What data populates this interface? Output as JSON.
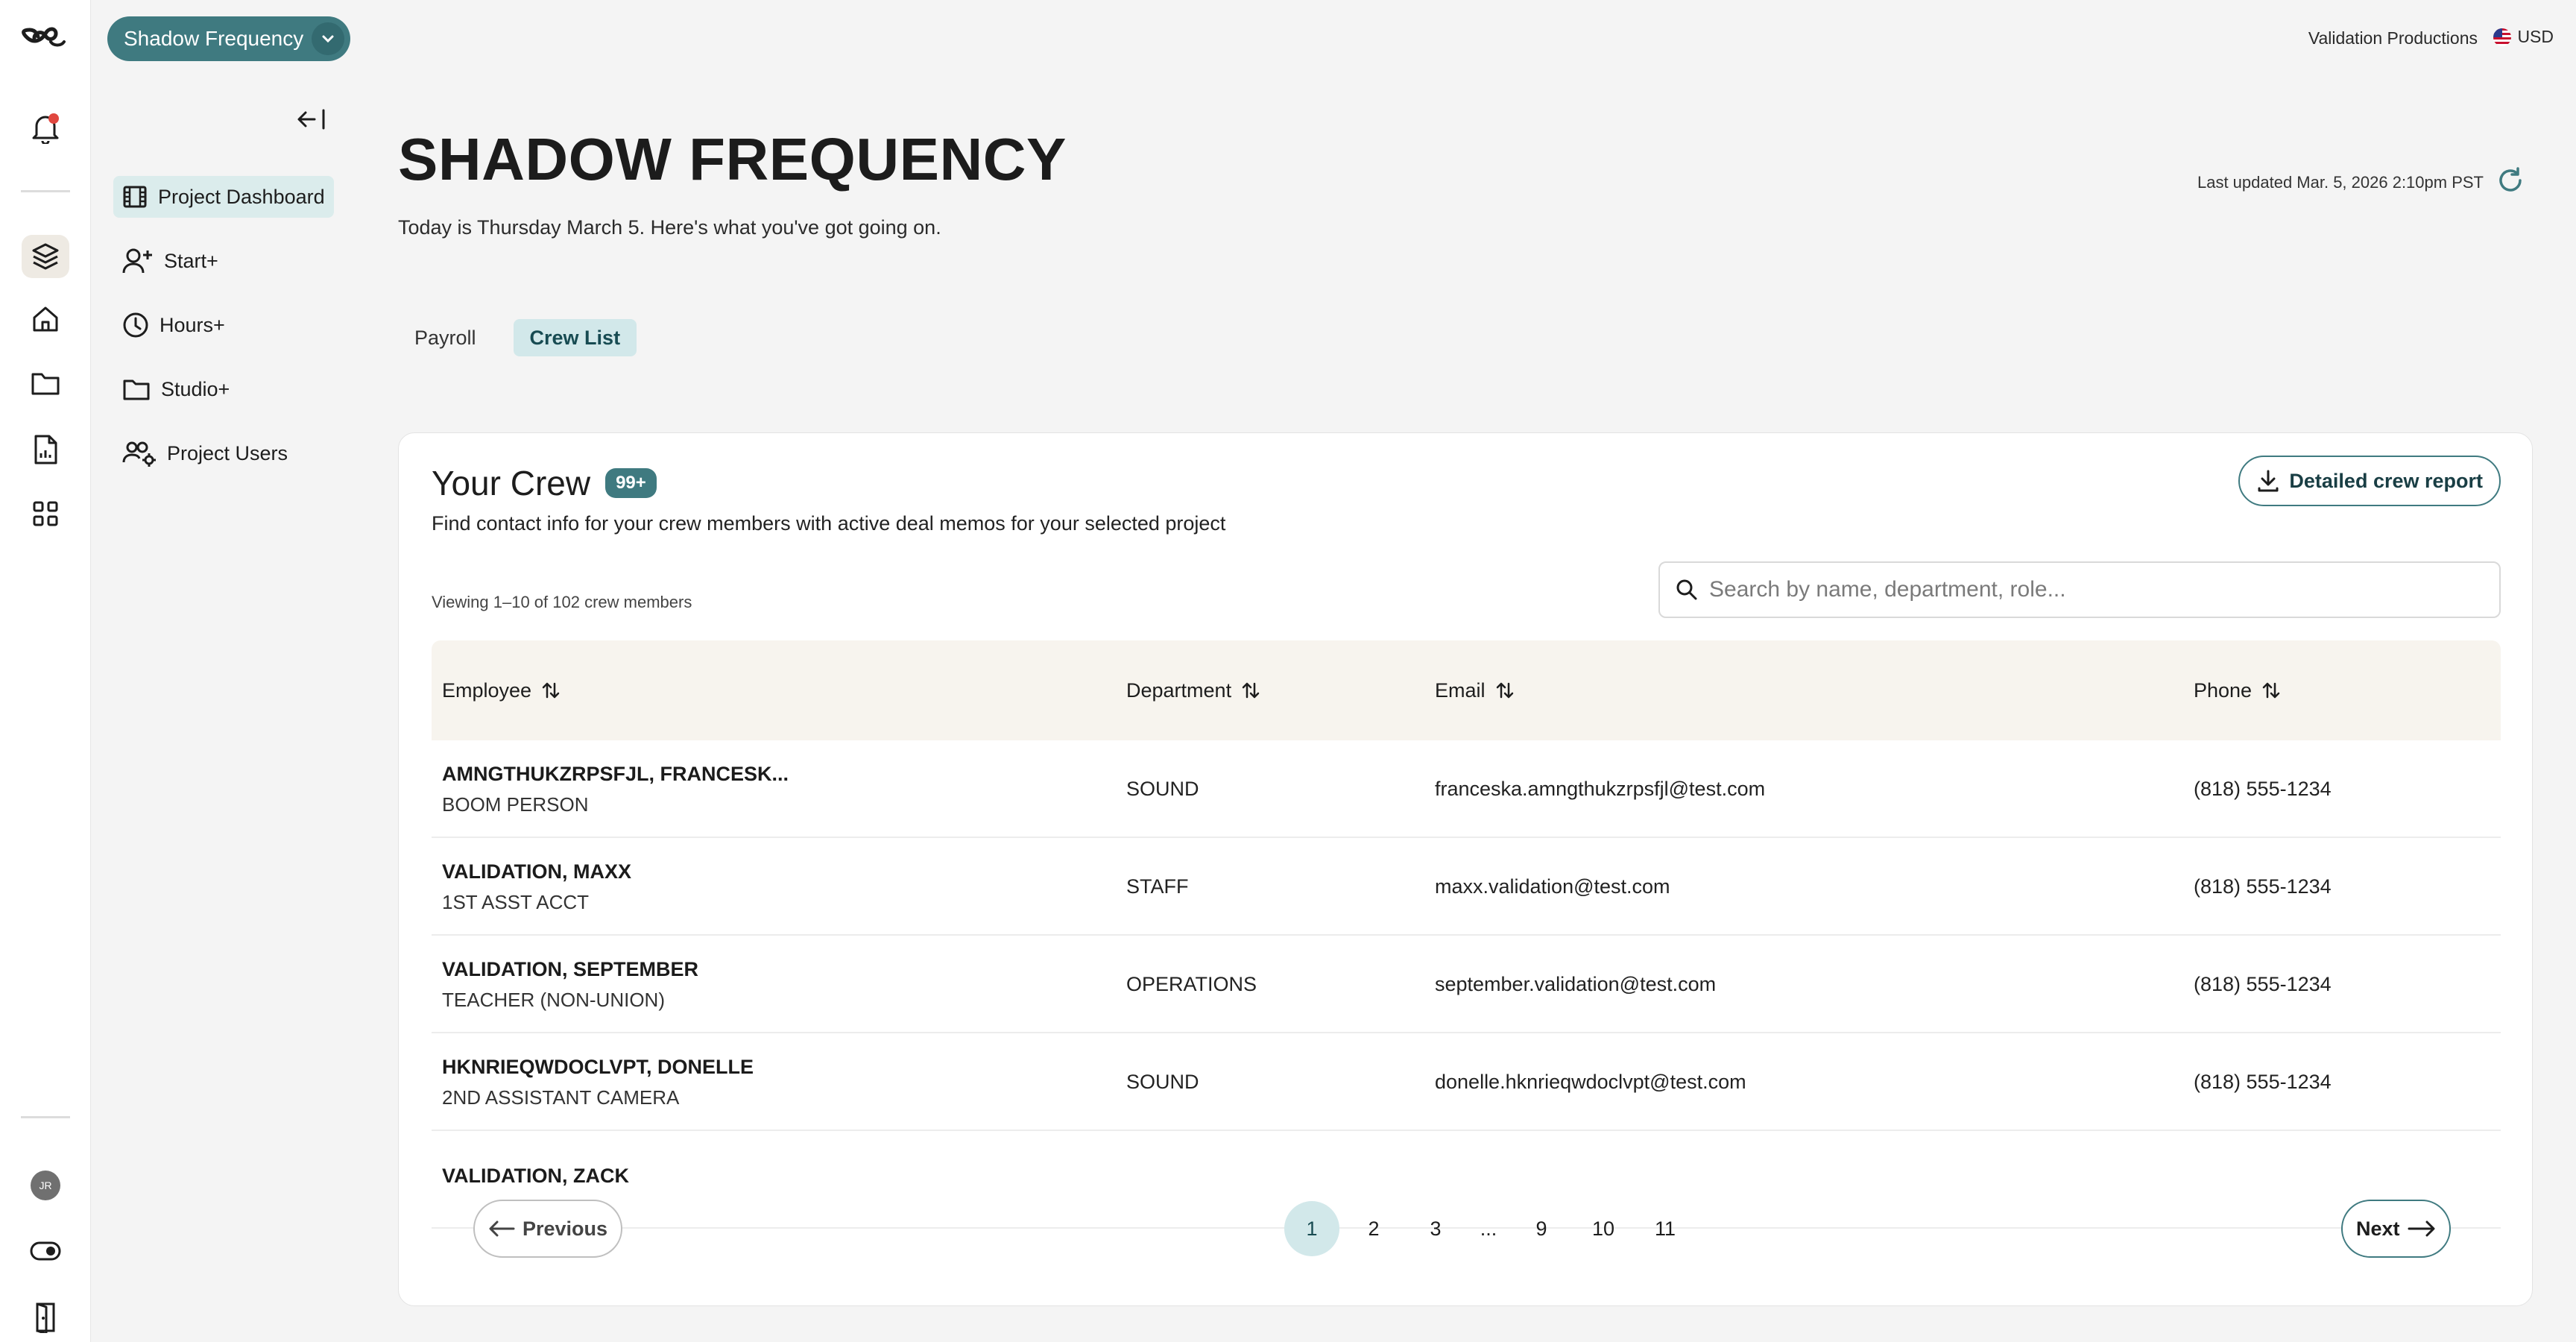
{
  "app": {
    "project_selector": "Shadow Frequency",
    "company": "Validation Productions",
    "currency": "USD",
    "avatar_initials": "JR"
  },
  "nav": {
    "items": [
      {
        "label": "Project Dashboard",
        "icon": "film-icon",
        "active": true
      },
      {
        "label": "Start+",
        "icon": "user-plus-icon",
        "active": false
      },
      {
        "label": "Hours+",
        "icon": "clock-icon",
        "active": false
      },
      {
        "label": "Studio+",
        "icon": "folder-icon",
        "active": false
      },
      {
        "label": "Project Users",
        "icon": "users-gear-icon",
        "active": false
      }
    ]
  },
  "header": {
    "title": "SHADOW FREQUENCY",
    "subtitle": "Today is Thursday March 5. Here's what you've got going on.",
    "last_updated": "Last updated Mar. 5, 2026 2:10pm PST"
  },
  "tabs": [
    {
      "label": "Payroll",
      "active": false
    },
    {
      "label": "Crew List",
      "active": true
    }
  ],
  "crew": {
    "title": "Your Crew",
    "badge": "99+",
    "description": "Find contact info for your crew members with active deal memos for your selected project",
    "report_button": "Detailed crew report",
    "viewing": "Viewing 1–10 of 102 crew members",
    "search_placeholder": "Search by name, department, role...",
    "columns": [
      "Employee",
      "Department",
      "Email",
      "Phone"
    ],
    "rows": [
      {
        "name": "AMNGTHUKZRPSFJL, FRANCESK...",
        "role": "BOOM PERSON",
        "department": "SOUND",
        "email": "franceska.amngthukzrpsfjl@test.com",
        "phone": "(818) 555-1234"
      },
      {
        "name": "VALIDATION, MAXX",
        "role": "1ST ASST ACCT",
        "department": "STAFF",
        "email": "maxx.validation@test.com",
        "phone": "(818) 555-1234"
      },
      {
        "name": "VALIDATION, SEPTEMBER",
        "role": "TEACHER (NON-UNION)",
        "department": "OPERATIONS",
        "email": "september.validation@test.com",
        "phone": "(818) 555-1234"
      },
      {
        "name": "HKNRIEQWDOCLVPT, DONELLE",
        "role": "2ND ASSISTANT CAMERA",
        "department": "SOUND",
        "email": "donelle.hknrieqwdoclvpt@test.com",
        "phone": "(818) 555-1234"
      },
      {
        "name": "VALIDATION, ZACK",
        "role": "",
        "department": "",
        "email": "",
        "phone": ""
      }
    ]
  },
  "pagination": {
    "previous": "Previous",
    "next": "Next",
    "pages": [
      "1",
      "2",
      "3",
      "...",
      "9",
      "10",
      "11"
    ],
    "current": "1"
  },
  "colors": {
    "accent": "#3f7a80",
    "accent_light": "#d2e8ea",
    "header_row": "#f7f4ee",
    "notification": "#e0473f"
  }
}
